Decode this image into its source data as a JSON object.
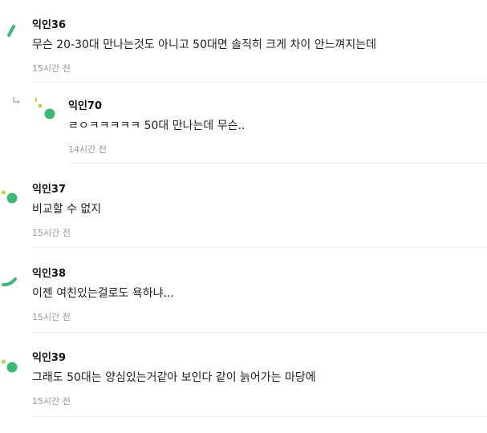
{
  "comments": [
    {
      "author": "익인36",
      "text": "무슨 20-30대 만나는것도 아니고 50대면 솔직히 크게 차이 안느껴지는데",
      "time": "15시간 전",
      "avatar_icon": "green-slash-icon"
    },
    {
      "author": "익인70",
      "text": "ㄹㅇㅋㅋㅋㅋㅋ 50대 만나는데 무슨..",
      "time": "14시간 전",
      "avatar_icon": "green-dots-icon",
      "is_reply": true
    },
    {
      "author": "익인37",
      "text": "비교할 수 없지",
      "time": "15시간 전",
      "avatar_icon": "green-dots-icon"
    },
    {
      "author": "익인38",
      "text": "이젠 여친있는걸로도 욕하냐...",
      "time": "15시간 전",
      "avatar_icon": "green-arc-icon"
    },
    {
      "author": "익인39",
      "text": "그래도 50대는 양심있는거같아 보인다 같이 늙어가는 마당에",
      "time": "15시간 전",
      "avatar_icon": "green-dots-icon"
    }
  ],
  "colors": {
    "avatar_green": "#3cb878",
    "avatar_lime": "#b5d33d",
    "time_gray": "#999999",
    "divider": "#ececec"
  }
}
